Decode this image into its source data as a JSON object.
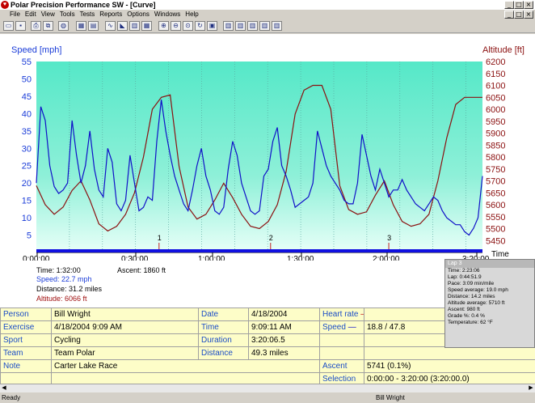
{
  "window": {
    "title": "Polar Precision Performance SW - [Curve]"
  },
  "menu": [
    "File",
    "Edit",
    "View",
    "Tools",
    "Tests",
    "Reports",
    "Options",
    "Windows",
    "Help"
  ],
  "toolbar_icons": [
    "open-icon",
    "save-icon",
    "print-icon",
    "copy-icon",
    "globe-icon",
    "calendar-icon",
    "book-icon",
    "curve-icon",
    "area-icon",
    "bar-icon",
    "table-icon",
    "zoom-in-icon",
    "zoom-out-icon",
    "zoom-full-icon",
    "sync-icon",
    "overview-icon",
    "chart1-icon",
    "chart2-icon",
    "chart3-icon",
    "chart4-icon",
    "chart5-icon"
  ],
  "chart_data": {
    "type": "line",
    "left_axis": {
      "label": "Speed [mph]",
      "ticks": [
        "55",
        "50",
        "45",
        "40",
        "35",
        "30",
        "25",
        "20",
        "15",
        "10",
        "5"
      ],
      "ylim": [
        0,
        55
      ]
    },
    "right_axis": {
      "label": "Altitude [ft]",
      "ticks": [
        "6200",
        "6150",
        "6100",
        "6050",
        "6000",
        "5950",
        "5900",
        "5850",
        "5800",
        "5750",
        "5700",
        "5650",
        "5600",
        "5550",
        "5500",
        "5450"
      ],
      "ylim": [
        5400,
        6200
      ]
    },
    "x_axis": {
      "label": "Time",
      "ticks": [
        "0:00:00",
        "0:30:00",
        "1:00:00",
        "1:30:00",
        "2:00:00",
        "3:20:00"
      ]
    },
    "series": [
      {
        "color": "#1010c8",
        "x_min": [
          0,
          2,
          4,
          6,
          8,
          10,
          12,
          14,
          16,
          18,
          20,
          22,
          24,
          26,
          28,
          30,
          32,
          34,
          36,
          38,
          40,
          42,
          44,
          46,
          48,
          50,
          52,
          54,
          56,
          58,
          60,
          62,
          64,
          66,
          68,
          70,
          72,
          74,
          76,
          78,
          80,
          82,
          84,
          86,
          88,
          90,
          92,
          94,
          96,
          98,
          100,
          102,
          104,
          106,
          108,
          110,
          112,
          114,
          116,
          118,
          120,
          122,
          124,
          126,
          128,
          130,
          132,
          134,
          136,
          138,
          140,
          142,
          144,
          146,
          148,
          150,
          152,
          154,
          156,
          158,
          160,
          162,
          164,
          166,
          168,
          170,
          172,
          174,
          176,
          178,
          180,
          182,
          184,
          186,
          188,
          190,
          192,
          194,
          196,
          198,
          200
        ],
        "values": [
          20,
          42,
          38,
          25,
          19,
          17,
          18,
          20,
          38,
          28,
          20,
          25,
          35,
          24,
          18,
          16,
          30,
          26,
          14,
          12,
          15,
          28,
          20,
          12,
          13,
          16,
          15,
          32,
          44,
          35,
          28,
          22,
          18,
          14,
          12,
          18,
          25,
          30,
          22,
          18,
          12,
          11,
          13,
          24,
          32,
          28,
          20,
          16,
          12,
          11,
          12,
          22,
          24,
          32,
          36,
          25,
          22,
          18,
          13,
          14,
          15,
          16,
          20,
          35,
          30,
          25,
          22,
          20,
          18,
          15,
          14,
          14,
          20,
          34,
          28,
          22,
          18,
          24,
          20,
          16,
          18,
          18,
          21,
          18,
          16,
          14,
          13,
          12,
          14,
          16,
          15,
          12,
          10,
          9,
          8,
          8,
          6,
          5,
          7,
          10,
          22
        ]
      },
      {
        "color": "#8b1010",
        "x_min": [
          0,
          4,
          8,
          12,
          16,
          20,
          24,
          28,
          32,
          36,
          40,
          44,
          48,
          52,
          56,
          60,
          64,
          68,
          72,
          76,
          80,
          84,
          88,
          92,
          96,
          100,
          104,
          108,
          112,
          116,
          120,
          124,
          128,
          132,
          136,
          140,
          144,
          148,
          152,
          156,
          160,
          164,
          168,
          172,
          176,
          180,
          184,
          188,
          192,
          196,
          200
        ],
        "values": [
          5680,
          5600,
          5560,
          5590,
          5660,
          5700,
          5620,
          5520,
          5490,
          5510,
          5560,
          5650,
          5800,
          6000,
          6050,
          6060,
          5760,
          5590,
          5540,
          5560,
          5620,
          5690,
          5630,
          5560,
          5510,
          5500,
          5530,
          5600,
          5740,
          5980,
          6080,
          6100,
          6100,
          6000,
          5680,
          5580,
          5560,
          5570,
          5640,
          5700,
          5600,
          5530,
          5510,
          5520,
          5560,
          5700,
          5880,
          6020,
          6050,
          6050,
          6050
        ]
      }
    ],
    "lap_markers": [
      "1",
      "2",
      "3"
    ],
    "readout": {
      "time": "Time: 1:32:00",
      "ascent": "Ascent: 1860 ft",
      "speed": "Speed: 22.7 mph",
      "distance": "Distance: 31.2 miles",
      "altitude": "Altitude: 6066 ft"
    }
  },
  "lap_box": {
    "title": "Lap 3",
    "lines": [
      "Time: 2:23:06",
      "Lap: 0:44:51.9",
      "Pace: 3:09 min/mile",
      "Speed average: 19.0 mph",
      "Distance: 14.2 miles",
      "Altitude average: 5710 ft",
      "Ascent: 980 ft",
      "Grade %: 0.4 %",
      "Temperature: 62 °F"
    ]
  },
  "grid": {
    "person_label": "Person",
    "person": "Bill Wright",
    "exercise_label": "Exercise",
    "exercise": "4/18/2004 9:09 AM",
    "sport_label": "Sport",
    "sport": "Cycling",
    "team_label": "Team",
    "team": "Team Polar",
    "note_label": "Note",
    "note": "Carter Lake Race",
    "date_label": "Date",
    "date": "4/18/2004",
    "time_label": "Time",
    "time": "9:09:11 AM",
    "duration_label": "Duration",
    "duration": "3:20:06.5",
    "distance_label": "Distance",
    "distance": "49.3 miles",
    "hr_label": "Heart rate",
    "speed_label": "Speed",
    "speed": "18.8 / 47.8",
    "ascent_label": "Ascent",
    "ascent": "5741 (0.1%)",
    "selection_label": "Selection",
    "selection": "0:00:00 - 3:20:00 (3:20:00.0)"
  },
  "status": {
    "left": "Ready",
    "right": "Bill Wright"
  }
}
